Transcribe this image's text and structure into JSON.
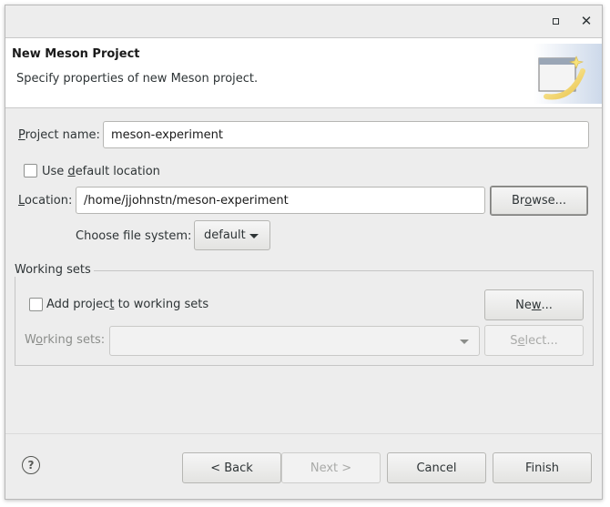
{
  "header": {
    "title": "New Meson Project",
    "description": "Specify properties of new Meson project."
  },
  "form": {
    "project_name_label_u": "P",
    "project_name_label_rest": "roject name:",
    "project_name_value": "meson-experiment",
    "use_default_pre": "Use ",
    "use_default_u": "d",
    "use_default_post": "efault location",
    "use_default_checked": false,
    "location_label_u": "L",
    "location_label_rest": "ocation:",
    "location_value": "/home/jjohnstn/meson-experiment",
    "browse_pre": "Br",
    "browse_u": "o",
    "browse_post": "wse...",
    "filesystem_label": "Choose file system:",
    "filesystem_value": "default"
  },
  "working_sets": {
    "group_title": "Working sets",
    "add_pre": "Add projec",
    "add_u": "t",
    "add_post": " to working sets",
    "add_checked": false,
    "new_pre": "Ne",
    "new_u": "w",
    "new_post": "...",
    "sets_label_pre": "W",
    "sets_label_u": "o",
    "sets_label_post": "rking sets:",
    "select_pre": "S",
    "select_u": "e",
    "select_post": "lect..."
  },
  "buttons": {
    "back": "< Back",
    "next": "Next >",
    "cancel": "Cancel",
    "finish": "Finish"
  },
  "icons": {
    "maximize": "maximize-icon",
    "close": "close-icon",
    "help": "help-icon",
    "wizard_banner": "wizard-banner-icon"
  }
}
